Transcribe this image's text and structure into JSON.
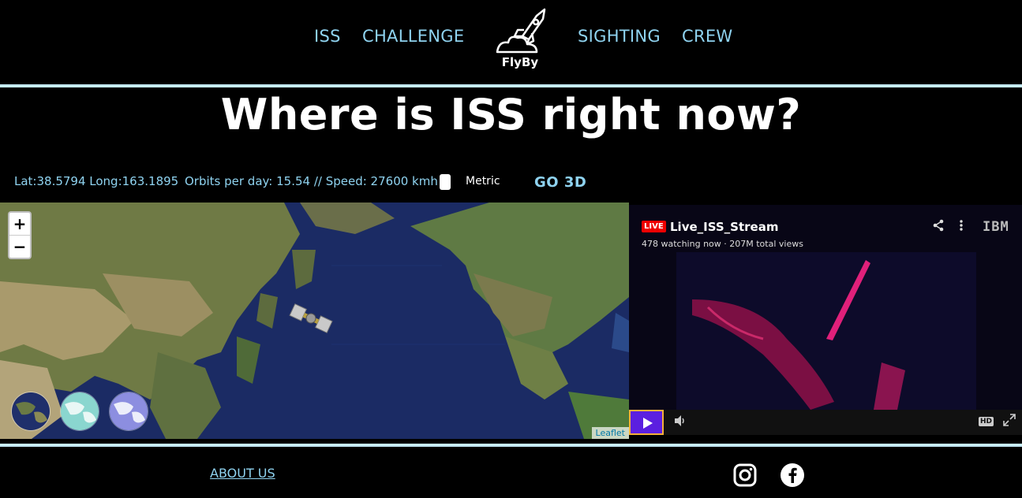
{
  "nav": {
    "items": [
      "ISS",
      "CHALLENGE",
      "SIGHTING",
      "CREW"
    ],
    "logo_text": "FlyBy"
  },
  "headline": "Where is ISS right now?",
  "info": {
    "coords": "Lat:38.5794 Long:163.1895",
    "orbits": "Orbits per day: 15.54 // Speed: 27600 kmh",
    "unit_label": "Metric",
    "go3d_label": "GO 3D"
  },
  "map": {
    "zoom_in": "+",
    "zoom_out": "−",
    "attribution": "Leaflet"
  },
  "video": {
    "live_badge": "LIVE",
    "title": "Live_ISS_Stream",
    "stats": "478 watching now · 207M total views",
    "brand": "IBM",
    "hd_label": "HD"
  },
  "footer": {
    "about": "ABOUT US"
  },
  "colors": {
    "accent": "#8fd3f0",
    "rule": "#c6ecf7",
    "play_button": "#5b1fe0",
    "play_border": "#f3b03a",
    "live_red": "#ee0000"
  },
  "icons": [
    "rocket-logo-icon",
    "iss-satellite-icon",
    "share-icon",
    "more-icon",
    "volume-icon",
    "fullscreen-icon",
    "instagram-icon",
    "facebook-icon"
  ]
}
